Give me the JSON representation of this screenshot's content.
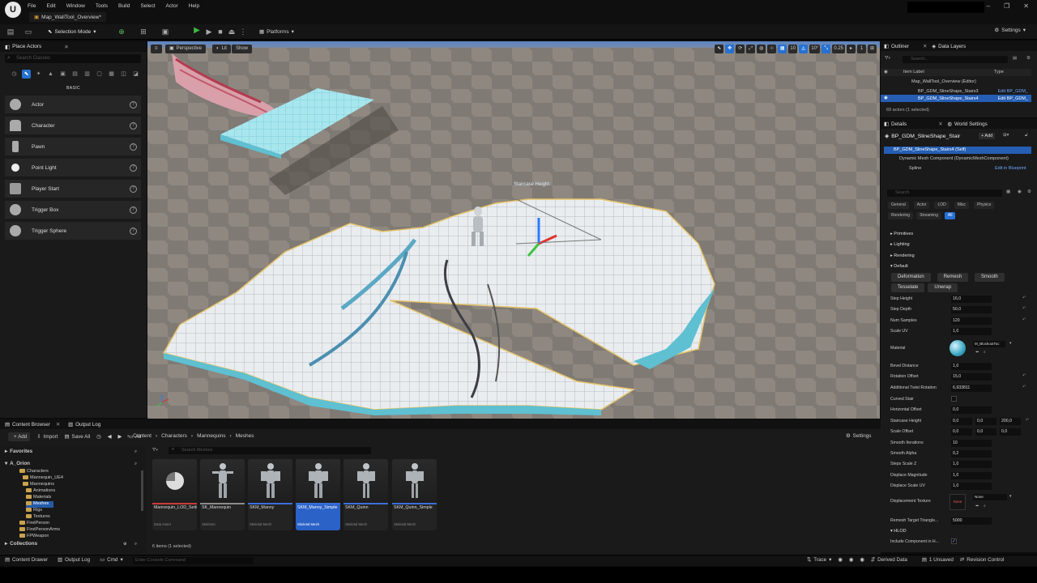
{
  "window": {
    "menu": [
      "File",
      "Edit",
      "Window",
      "Tools",
      "Build",
      "Select",
      "Actor",
      "Help"
    ],
    "map_tab": "Map_WallTool_Overview*",
    "controls": [
      "–",
      "❐",
      "✕"
    ]
  },
  "toolbar": {
    "selection_mode": "Selection Mode",
    "platforms": "Platforms",
    "settings": "Settings"
  },
  "place_actors": {
    "tab": "Place Actors",
    "search_placeholder": "Search Classes",
    "category_label": "BASIC",
    "items": [
      {
        "label": "Actor"
      },
      {
        "label": "Character"
      },
      {
        "label": "Pawn"
      },
      {
        "label": "Point Light"
      },
      {
        "label": "Player Start"
      },
      {
        "label": "Trigger Box"
      },
      {
        "label": "Trigger Sphere"
      }
    ]
  },
  "viewport": {
    "perspective": "Perspective",
    "lit": "Lit",
    "show": "Show",
    "grid_snap": "10",
    "rot_snap": "10°",
    "scale_snap": "0.25",
    "cam_speed": "1",
    "stair_label": "Staircase Height"
  },
  "outliner": {
    "tab": "Outliner",
    "tab2": "Data Layers",
    "search_placeholder": "Search...",
    "col_label": "Item Label",
    "col_type": "Type",
    "rows": [
      {
        "label": "Map_WallTool_Overview (Editor)",
        "type": ""
      },
      {
        "label": "BP_GDM_SlineShape_Stairs3",
        "type": "Edit BP_GDM_"
      },
      {
        "label": "BP_GDM_SlineShape_Stairs4",
        "type": "Edit BP_GDM_"
      }
    ],
    "count": "69 actors (1 selected)"
  },
  "details": {
    "tab": "Details",
    "tab2": "World Settings",
    "actor_name": "BP_GDM_SlineShape_Stair",
    "add": "+ Add",
    "self_row": "BP_GDM_SlineShape_Stairs4 (Self)",
    "component": "Dynamic Mesh Component (DynamicMeshComponent)",
    "spline": "Spline",
    "edit_bp": "Edit in Blueprint",
    "search_placeholder": "Search",
    "filters1": [
      "General",
      "Actor",
      "LOD",
      "Misc",
      "Physics"
    ],
    "filters2": [
      "Rendering",
      "Streaming",
      "All"
    ],
    "categories": [
      "Primitives",
      "Lighting",
      "Rendering",
      "Default"
    ],
    "buttons1": [
      "Deformation",
      "Remesh",
      "Smooth"
    ],
    "buttons2": [
      "Tesselate",
      "Unwrap"
    ],
    "props_a": [
      {
        "label": "Step Height",
        "value": "16,0"
      },
      {
        "label": "Step Depth",
        "value": "50,0"
      },
      {
        "label": "Num Samples",
        "value": "120"
      },
      {
        "label": "Scale UV",
        "value": "1,0"
      }
    ],
    "material_label": "Material",
    "material_value": "M_BlockoutToc",
    "props_b": [
      {
        "label": "Bevel Distance",
        "value": "1,0"
      },
      {
        "label": "Rotation Offset",
        "value": "15,0"
      },
      {
        "label": "Additional Twist Rotation",
        "value": "6,933811"
      },
      {
        "label": "Curved Stair",
        "value": ""
      },
      {
        "label": "Horizontal Offset",
        "value": "0,0"
      }
    ],
    "staircase_height": {
      "label": "Staircase Height",
      "v1": "0,0",
      "v2": "0,0",
      "v3": "200,0"
    },
    "scale_offset": {
      "label": "Scale Offset",
      "v1": "0,0",
      "v2": "0,0",
      "v3": "0,0"
    },
    "props_c": [
      {
        "label": "Smooth Iterations",
        "value": "10"
      },
      {
        "label": "Smooth Alpha",
        "value": "0,2"
      },
      {
        "label": "Steps Scale Z",
        "value": "1,0"
      },
      {
        "label": "Displace Magnitude",
        "value": "1,0"
      },
      {
        "label": "Displace Scale UV",
        "value": "1,0"
      }
    ],
    "displacement_label": "Displacement Texture",
    "displacement_value": "None",
    "remesh_label": "Remesh Target Triangle...",
    "remesh_value": "5000",
    "hlod": "HLOD",
    "include_hlod": "Include Component in H..."
  },
  "content_browser": {
    "tab": "Content Browser",
    "tab2": "Output Log",
    "add": "+ Add",
    "import": "Import",
    "save_all": "Save All",
    "all": "All",
    "crumbs": [
      "Content",
      "Characters",
      "Mannequins",
      "Meshes"
    ],
    "settings": "Settings",
    "favorites": "Favorites",
    "root": "A_Orion",
    "search_placeholder": "Search Meshes",
    "tree": [
      "Characters",
      "Mannequin_UE4",
      "Mannequins",
      "Animations",
      "Materials",
      "Meshes",
      "Rigs",
      "Textures",
      "FirstPerson",
      "FirstPersonArms",
      "FPWeapon"
    ],
    "collections": "Collections",
    "status": "6 items (1 selected)",
    "assets": [
      {
        "name": "Mannequin_LOD_Settings",
        "type": "Data Asset"
      },
      {
        "name": "SK_Mannequin",
        "type": "Skeleton"
      },
      {
        "name": "SKM_Manny",
        "type": "Skeletal Mesh"
      },
      {
        "name": "SKM_Manny_Simple",
        "type": "Skeletal Mesh"
      },
      {
        "name": "SKM_Quinn",
        "type": "Skeletal Mesh"
      },
      {
        "name": "SKM_Quinn_Simple",
        "type": "Skeletal Mesh"
      }
    ]
  },
  "statusbar": {
    "content_drawer": "Content Drawer",
    "output_log": "Output Log",
    "cmd": "Cmd",
    "console_placeholder": "Enter Console Command",
    "trace": "Trace",
    "derived": "Derived Data",
    "unsaved": "1 Unsaved",
    "revision": "Revision Control"
  },
  "colors": {
    "accent": "#2671d3",
    "panel": "#1a1a1a",
    "selected": "#255eb3"
  }
}
